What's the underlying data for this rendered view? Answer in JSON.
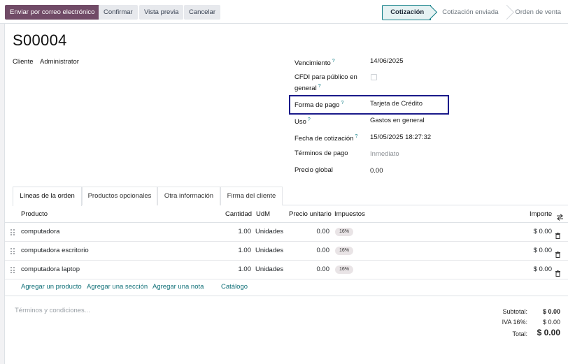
{
  "toolbar": {
    "send_email": "Enviar por correo electrónico",
    "confirm": "Confirmar",
    "preview": "Vista previa",
    "cancel": "Cancelar"
  },
  "statusbar": {
    "stages": [
      "Cotización",
      "Cotización enviada",
      "Orden de venta"
    ],
    "active": "Cotización"
  },
  "record": {
    "name": "S00004",
    "customer_label": "Cliente",
    "customer_value": "Administrator",
    "expiration_label": "Vencimiento",
    "expiration_value": "14/06/2025",
    "cfdi_label_line1": "CFDI para público en",
    "cfdi_label_line2": "general",
    "payment_form_label": "Forma de pago",
    "payment_form_value": "Tarjeta de Crédito",
    "use_label": "Uso",
    "use_value": "Gastos en general",
    "quote_date_label": "Fecha de cotización",
    "quote_date_value": "15/05/2025 18:27:32",
    "payment_terms_label": "Términos de pago",
    "payment_terms_placeholder": "Inmediato",
    "global_price_label": "Precio global",
    "global_price_value": "0.00"
  },
  "tabs": [
    "Líneas de la orden",
    "Productos opcionales",
    "Otra información",
    "Firma del cliente"
  ],
  "table": {
    "headers": {
      "product": "Producto",
      "qty": "Cantidad",
      "uom": "UdM",
      "price": "Precio unitario",
      "taxes": "Impuestos",
      "amount": "Importe"
    },
    "rows": [
      {
        "product": "computadora",
        "qty": "1.00",
        "uom": "Unidades",
        "price": "0.00",
        "tax": "16%",
        "amount": "$ 0.00"
      },
      {
        "product": "computadora escritorio",
        "qty": "1.00",
        "uom": "Unidades",
        "price": "0.00",
        "tax": "16%",
        "amount": "$ 0.00"
      },
      {
        "product": "computadora laptop",
        "qty": "1.00",
        "uom": "Unidades",
        "price": "0.00",
        "tax": "16%",
        "amount": "$ 0.00"
      }
    ],
    "add_product": "Agregar un producto",
    "add_section": "Agregar una sección",
    "add_note": "Agregar una nota",
    "catalog": "Catálogo"
  },
  "terms_placeholder": "Términos y condiciones...",
  "totals": {
    "subtotal_label": "Subtotal:",
    "subtotal_value": "$ 0.00",
    "iva_label": "IVA 16%:",
    "iva_value": "$ 0.00",
    "total_label": "Total:",
    "total_value": "$ 0.00"
  },
  "colors": {
    "primary": "#714b67",
    "accent": "#0f7d86",
    "highlight_box": "#1a1a8a"
  },
  "icons": [
    "drag-handle-icon",
    "trash-icon",
    "optional-columns-icon",
    "help-tooltip-icon"
  ]
}
